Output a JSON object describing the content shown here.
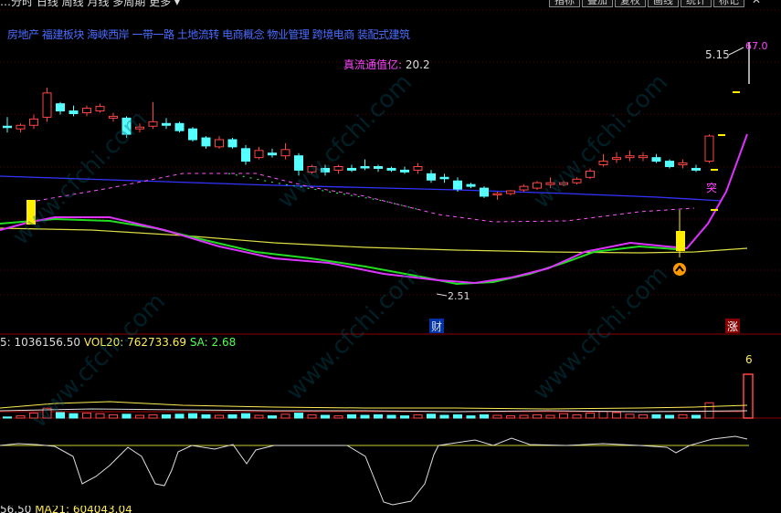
{
  "toolbar": {
    "left_text": "…分时  日线  周线  月线  多周期  更多 ▾",
    "buttons": [
      "指标",
      "叠加",
      "复权",
      "画线",
      "统计",
      "标记"
    ],
    "close_glyph": "✕"
  },
  "concept_tags": "房地产 福建板块 海峡西岸 一带一路 土地流转 电商概念 物业管理 跨境电商 装配式建筑",
  "market_cap": {
    "label": "真流通值亿:",
    "value": "20.2"
  },
  "annotations": {
    "high_label": "5.15",
    "low_label": "2.51",
    "pct_label": "67.0",
    "tu_marker": "突",
    "cai_marker": "财",
    "zhang_marker": "涨",
    "vol_peak_label": "6"
  },
  "volume_stats": {
    "vol_label": "5: 1036156.50",
    "vol20_label": "VOL20: 762733.69",
    "sa_label": "SA: 2.68"
  },
  "lower_stats": {
    "left": "56.50",
    "ma": "MA21: 604043.04"
  },
  "watermark": "www.cfchi.com",
  "colors": {
    "up": "#ff4444",
    "down": "#55ffff",
    "ma_blue": "#3333ff",
    "ma_yellow": "#dddd44",
    "ma_green": "#22dd22",
    "ma_magenta": "#dd33ff",
    "divider": "#8b0000",
    "highlight": "#ffee00"
  },
  "chart_data": {
    "type": "candlestick",
    "candles": [
      [
        4.25,
        4.35,
        4.18,
        4.24
      ],
      [
        4.22,
        4.28,
        4.18,
        4.26
      ],
      [
        4.26,
        4.38,
        4.22,
        4.33
      ],
      [
        4.35,
        4.68,
        4.3,
        4.62
      ],
      [
        4.5,
        4.52,
        4.38,
        4.42
      ],
      [
        4.42,
        4.48,
        4.36,
        4.39
      ],
      [
        4.4,
        4.48,
        4.36,
        4.45
      ],
      [
        4.42,
        4.5,
        4.4,
        4.47
      ],
      [
        4.34,
        4.4,
        4.3,
        4.36
      ],
      [
        4.34,
        4.36,
        4.12,
        4.16
      ],
      [
        4.22,
        4.28,
        4.18,
        4.24
      ],
      [
        4.25,
        4.52,
        4.22,
        4.3
      ],
      [
        4.28,
        4.34,
        4.22,
        4.26
      ],
      [
        4.28,
        4.3,
        4.18,
        4.2
      ],
      [
        4.22,
        4.24,
        4.08,
        4.1
      ],
      [
        4.12,
        4.14,
        4.0,
        4.03
      ],
      [
        4.02,
        4.14,
        4.0,
        4.1
      ],
      [
        4.1,
        4.12,
        4.0,
        4.02
      ],
      [
        4.0,
        4.04,
        3.82,
        3.86
      ],
      [
        3.9,
        4.02,
        3.88,
        3.98
      ],
      [
        3.95,
        4.0,
        3.9,
        3.93
      ],
      [
        3.92,
        4.06,
        3.88,
        3.99
      ],
      [
        3.92,
        3.95,
        3.7,
        3.76
      ],
      [
        3.74,
        3.82,
        3.72,
        3.8
      ],
      [
        3.78,
        3.82,
        3.7,
        3.74
      ],
      [
        3.76,
        3.82,
        3.72,
        3.8
      ],
      [
        3.78,
        3.82,
        3.74,
        3.76
      ],
      [
        3.8,
        3.88,
        3.76,
        3.79
      ],
      [
        3.8,
        3.82,
        3.74,
        3.78
      ],
      [
        3.78,
        3.8,
        3.74,
        3.76
      ],
      [
        3.76,
        3.8,
        3.72,
        3.74
      ],
      [
        3.76,
        3.84,
        3.72,
        3.8
      ],
      [
        3.72,
        3.76,
        3.62,
        3.65
      ],
      [
        3.68,
        3.72,
        3.62,
        3.67
      ],
      [
        3.64,
        3.68,
        3.52,
        3.55
      ],
      [
        3.6,
        3.62,
        3.56,
        3.58
      ],
      [
        3.56,
        3.58,
        3.45,
        3.47
      ],
      [
        3.5,
        3.52,
        3.43,
        3.5
      ],
      [
        3.5,
        3.54,
        3.48,
        3.53
      ],
      [
        3.54,
        3.6,
        3.52,
        3.58
      ],
      [
        3.56,
        3.64,
        3.54,
        3.62
      ],
      [
        3.6,
        3.68,
        3.56,
        3.62
      ],
      [
        3.6,
        3.64,
        3.58,
        3.62
      ],
      [
        3.62,
        3.68,
        3.6,
        3.66
      ],
      [
        3.68,
        3.78,
        3.66,
        3.75
      ],
      [
        3.82,
        3.94,
        3.8,
        3.86
      ],
      [
        3.88,
        3.96,
        3.84,
        3.9
      ],
      [
        3.9,
        3.98,
        3.86,
        3.92
      ],
      [
        3.9,
        3.96,
        3.86,
        3.92
      ],
      [
        3.9,
        3.94,
        3.84,
        3.86
      ],
      [
        3.86,
        3.88,
        3.78,
        3.8
      ],
      [
        3.82,
        3.88,
        3.78,
        3.84
      ],
      [
        3.78,
        3.82,
        3.74,
        3.76
      ],
      [
        3.86,
        4.16,
        3.84,
        4.14
      ]
    ],
    "ylim": [
      2.3,
      5.3
    ]
  }
}
